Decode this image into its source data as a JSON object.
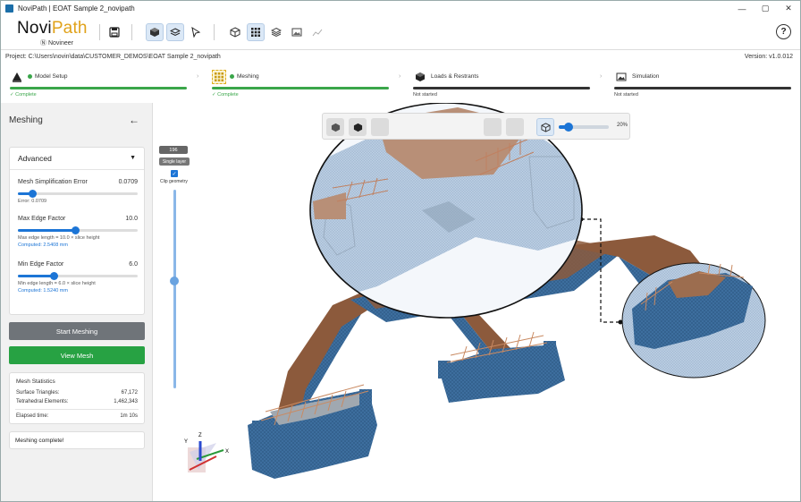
{
  "window": {
    "title": "NoviPath | EOAT Sample 2_novipath",
    "controls": [
      "—",
      "▢",
      "✕"
    ]
  },
  "logo": {
    "part1": "Novi",
    "part2": "Path",
    "sub": "Ⓝ Novineer"
  },
  "project": {
    "path": "Project: C:\\Users\\novin\\data\\CUSTOMER_DEMOS\\EOAT Sample 2_novipath",
    "version": "Version: v1.0.012"
  },
  "help_label": "?",
  "steps": [
    {
      "label": "Model Setup",
      "status": "✓ Complete",
      "progress": 1.0
    },
    {
      "label": "Meshing",
      "status": "✓ Complete",
      "progress": 1.0
    },
    {
      "label": "Loads & Restrants",
      "status": "Not started",
      "progress": 0
    },
    {
      "label": "Simulation",
      "status": "Not started",
      "progress": 0
    }
  ],
  "panel": {
    "title": "Meshing",
    "back_icon": "←",
    "advanced": {
      "label": "Advanced",
      "params": [
        {
          "name": "Mesh Simplification Error",
          "value": "0.0709",
          "hint": "Error: 0.0709",
          "computed": "",
          "fraction": 0.12
        },
        {
          "name": "Max Edge Factor",
          "value": "10.0",
          "hint": "Max edge length = 10.0 × slice height",
          "computed": "Computed: 2.5408 mm",
          "fraction": 0.48
        },
        {
          "name": "Min Edge Factor",
          "value": "6.0",
          "hint": "Min edge length = 6.0 × slice height",
          "computed": "Computed: 1.5240 mm",
          "fraction": 0.3
        }
      ]
    },
    "start_meshing": "Start Meshing",
    "view_mesh": "View Mesh",
    "stats": {
      "title": "Mesh Statistics",
      "surface_label": "Surface Triangles:",
      "surface_value": "67,172",
      "tet_label": "Tetrahedral Elements:",
      "tet_value": "1,462,343",
      "elapsed_label": "Elapsed time:",
      "elapsed_value": "1m 10s"
    },
    "status": "Meshing complete!"
  },
  "viewport": {
    "layer_value": "196",
    "single_layer": "Single layer",
    "clip_label": "Clip geometry",
    "clip_checked": true,
    "layer_fraction": 0.46,
    "opacity": "20%",
    "opacity_fraction": 0.2,
    "axes": {
      "x": "X",
      "y": "Y",
      "z": "Z"
    }
  },
  "colors": {
    "accent": "#1c75d6",
    "complete": "#3aa64a",
    "start_btn": "#6f7479",
    "view_btn": "#27a243",
    "mesh_blue": "#3d6e9e",
    "top_brown": "#8c5a3c"
  }
}
